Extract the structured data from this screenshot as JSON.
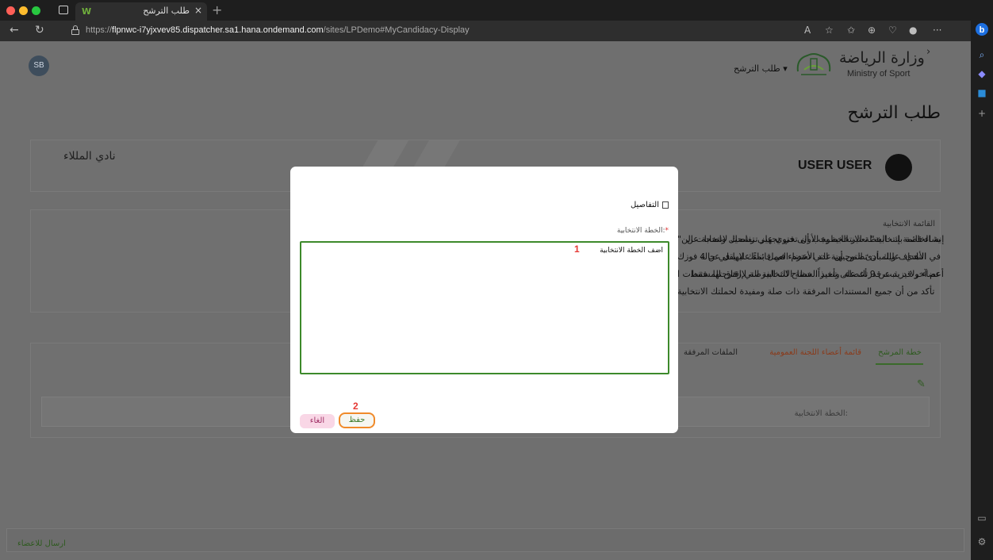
{
  "browser": {
    "tab_title": "طلب الترشح",
    "tab_close": "×",
    "new_tab": "+",
    "url_prefix": "https://",
    "url_host": "flpnwc-i7yjxvev85.dispatcher.sa1.hana.ondemand.com",
    "url_path": "/sites/LPDemo#MyCandidacy-Display",
    "favicon_letter": "W"
  },
  "header": {
    "user_initials": "SB",
    "ministry_ar": "وزارة الرياضة",
    "ministry_en": "Ministry of Sport",
    "nav_candidacy": "طلب الترشح ▾",
    "page_title": "طلب الترشح"
  },
  "profile": {
    "club_name": "نادي المللاء",
    "user_name": "USER USER"
  },
  "intro": {
    "heading": "القائمة الانتخابية",
    "lines": [
      "\"إنشاء قائمة إنتخابية\" تعتبر الخطوة الأولى في تجهيز ترشحك لانتخابات الن",
      "الأهداف والمبادئ التوجيهية التي تعتزم العمل بناءً عليها في حالة فوزك",
      "أعضاء ولا يزيد عن 9 أعضاء. وأخيراً، ستتاح لك الفرصة لإرفاق المستندات ا",
      "تأكد من أن جميع المستندات المرفقة ذات صلة ومفيدة لحملتك الانتخابية",
      "ية الخاصة بك. الخطة الانتخابية يجب أن تحتوي على تفاصيل واضحة عن",
      "في النادي. عليك أن تضمن أن عدد الأعضاء في قائمتك لا يقل عن 4",
      "عم آخر قد يثبت قدرتك على تنفيذ الخطة الانتخابية التي اقترحتها. فقط"
    ]
  },
  "tabs": [
    "خطة المرشح",
    "قائمة أعضاء اللجنة العمومية",
    "الملفات المرفقة"
  ],
  "election_plan_label": "الخطة الانتخابية:",
  "footer": {
    "send_label": "ارسال للاعضاء"
  },
  "modal": {
    "title": "التفاصيل",
    "field_label": "الخطة الانتخابية:",
    "required_mark": "*",
    "textarea_value": "اضف الخطة الانتخابية",
    "marker_1": "1",
    "marker_2": "2",
    "save_label": "حفظ",
    "cancel_label": "الغاء"
  },
  "colors": {
    "accent_green": "#3d8a2b",
    "highlight_orange": "#f08a2a",
    "cancel_pink": "#f9d7e6",
    "marker_red": "#e53935"
  }
}
